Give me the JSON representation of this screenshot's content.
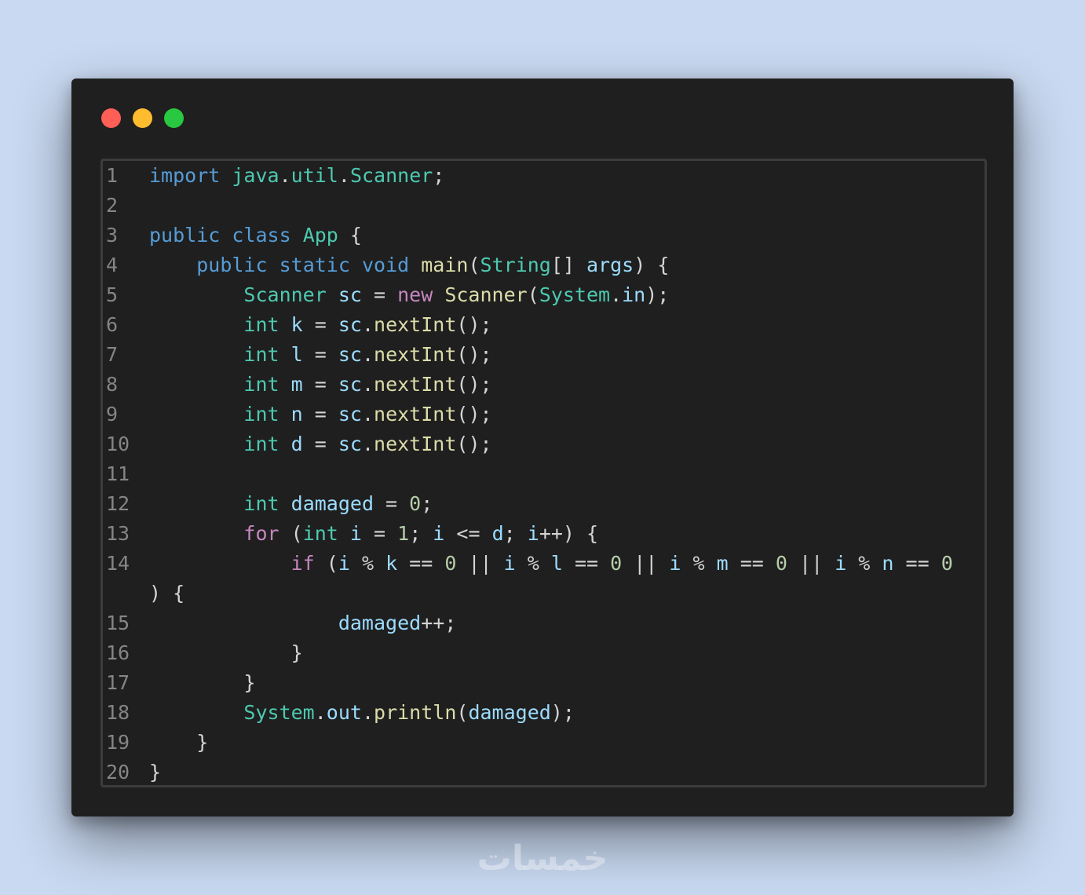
{
  "window": {
    "controls": [
      "close",
      "minimize",
      "maximize"
    ]
  },
  "code_lines": [
    {
      "n": "1",
      "tokens": [
        [
          "kw",
          "import"
        ],
        [
          "pun",
          " "
        ],
        [
          "ty",
          "java"
        ],
        [
          "pun",
          "."
        ],
        [
          "ty",
          "util"
        ],
        [
          "pun",
          "."
        ],
        [
          "ty",
          "Scanner"
        ],
        [
          "pun",
          ";"
        ]
      ]
    },
    {
      "n": "2",
      "tokens": []
    },
    {
      "n": "3",
      "tokens": [
        [
          "kw",
          "public"
        ],
        [
          "pun",
          " "
        ],
        [
          "kw",
          "class"
        ],
        [
          "pun",
          " "
        ],
        [
          "ty",
          "App"
        ],
        [
          "pun",
          " {"
        ]
      ]
    },
    {
      "n": "4",
      "tokens": [
        [
          "pun",
          "    "
        ],
        [
          "kw",
          "public"
        ],
        [
          "pun",
          " "
        ],
        [
          "kw",
          "static"
        ],
        [
          "pun",
          " "
        ],
        [
          "kw",
          "void"
        ],
        [
          "pun",
          " "
        ],
        [
          "fn",
          "main"
        ],
        [
          "pun",
          "("
        ],
        [
          "ty",
          "String"
        ],
        [
          "pun",
          "[] "
        ],
        [
          "var",
          "args"
        ],
        [
          "pun",
          ") {"
        ]
      ]
    },
    {
      "n": "5",
      "tokens": [
        [
          "pun",
          "        "
        ],
        [
          "ty",
          "Scanner"
        ],
        [
          "pun",
          " "
        ],
        [
          "var",
          "sc"
        ],
        [
          "pun",
          " = "
        ],
        [
          "ctl",
          "new"
        ],
        [
          "pun",
          " "
        ],
        [
          "fn",
          "Scanner"
        ],
        [
          "pun",
          "("
        ],
        [
          "ty",
          "System"
        ],
        [
          "pun",
          "."
        ],
        [
          "var",
          "in"
        ],
        [
          "pun",
          ");"
        ]
      ]
    },
    {
      "n": "6",
      "tokens": [
        [
          "pun",
          "        "
        ],
        [
          "ty",
          "int"
        ],
        [
          "pun",
          " "
        ],
        [
          "var",
          "k"
        ],
        [
          "pun",
          " = "
        ],
        [
          "var",
          "sc"
        ],
        [
          "pun",
          "."
        ],
        [
          "fn",
          "nextInt"
        ],
        [
          "pun",
          "();"
        ]
      ]
    },
    {
      "n": "7",
      "tokens": [
        [
          "pun",
          "        "
        ],
        [
          "ty",
          "int"
        ],
        [
          "pun",
          " "
        ],
        [
          "var",
          "l"
        ],
        [
          "pun",
          " = "
        ],
        [
          "var",
          "sc"
        ],
        [
          "pun",
          "."
        ],
        [
          "fn",
          "nextInt"
        ],
        [
          "pun",
          "();"
        ]
      ]
    },
    {
      "n": "8",
      "tokens": [
        [
          "pun",
          "        "
        ],
        [
          "ty",
          "int"
        ],
        [
          "pun",
          " "
        ],
        [
          "var",
          "m"
        ],
        [
          "pun",
          " = "
        ],
        [
          "var",
          "sc"
        ],
        [
          "pun",
          "."
        ],
        [
          "fn",
          "nextInt"
        ],
        [
          "pun",
          "();"
        ]
      ]
    },
    {
      "n": "9",
      "tokens": [
        [
          "pun",
          "        "
        ],
        [
          "ty",
          "int"
        ],
        [
          "pun",
          " "
        ],
        [
          "var",
          "n"
        ],
        [
          "pun",
          " = "
        ],
        [
          "var",
          "sc"
        ],
        [
          "pun",
          "."
        ],
        [
          "fn",
          "nextInt"
        ],
        [
          "pun",
          "();"
        ]
      ]
    },
    {
      "n": "10",
      "tokens": [
        [
          "pun",
          "        "
        ],
        [
          "ty",
          "int"
        ],
        [
          "pun",
          " "
        ],
        [
          "var",
          "d"
        ],
        [
          "pun",
          " = "
        ],
        [
          "var",
          "sc"
        ],
        [
          "pun",
          "."
        ],
        [
          "fn",
          "nextInt"
        ],
        [
          "pun",
          "();"
        ]
      ]
    },
    {
      "n": "11",
      "tokens": []
    },
    {
      "n": "12",
      "tokens": [
        [
          "pun",
          "        "
        ],
        [
          "ty",
          "int"
        ],
        [
          "pun",
          " "
        ],
        [
          "var",
          "damaged"
        ],
        [
          "pun",
          " = "
        ],
        [
          "num",
          "0"
        ],
        [
          "pun",
          ";"
        ]
      ]
    },
    {
      "n": "13",
      "tokens": [
        [
          "pun",
          "        "
        ],
        [
          "ctl",
          "for"
        ],
        [
          "pun",
          " ("
        ],
        [
          "ty",
          "int"
        ],
        [
          "pun",
          " "
        ],
        [
          "var",
          "i"
        ],
        [
          "pun",
          " = "
        ],
        [
          "num",
          "1"
        ],
        [
          "pun",
          "; "
        ],
        [
          "var",
          "i"
        ],
        [
          "pun",
          " <= "
        ],
        [
          "var",
          "d"
        ],
        [
          "pun",
          "; "
        ],
        [
          "var",
          "i"
        ],
        [
          "pun",
          "++) {"
        ]
      ]
    },
    {
      "n": "14",
      "tokens": [
        [
          "pun",
          "            "
        ],
        [
          "ctl",
          "if"
        ],
        [
          "pun",
          " ("
        ],
        [
          "var",
          "i"
        ],
        [
          "pun",
          " % "
        ],
        [
          "var",
          "k"
        ],
        [
          "pun",
          " == "
        ],
        [
          "num",
          "0"
        ],
        [
          "pun",
          " || "
        ],
        [
          "var",
          "i"
        ],
        [
          "pun",
          " % "
        ],
        [
          "var",
          "l"
        ],
        [
          "pun",
          " == "
        ],
        [
          "num",
          "0"
        ],
        [
          "pun",
          " || "
        ],
        [
          "var",
          "i"
        ],
        [
          "pun",
          " % "
        ],
        [
          "var",
          "m"
        ],
        [
          "pun",
          " == "
        ],
        [
          "num",
          "0"
        ],
        [
          "pun",
          " || "
        ],
        [
          "var",
          "i"
        ],
        [
          "pun",
          " % "
        ],
        [
          "var",
          "n"
        ],
        [
          "pun",
          " == "
        ],
        [
          "num",
          "0"
        ]
      ]
    },
    {
      "n": "",
      "tokens": [
        [
          "pun",
          ") {"
        ]
      ]
    },
    {
      "n": "15",
      "tokens": [
        [
          "pun",
          "                "
        ],
        [
          "var",
          "damaged"
        ],
        [
          "pun",
          "++;"
        ]
      ]
    },
    {
      "n": "16",
      "tokens": [
        [
          "pun",
          "            }"
        ]
      ]
    },
    {
      "n": "17",
      "tokens": [
        [
          "pun",
          "        }"
        ]
      ]
    },
    {
      "n": "18",
      "tokens": [
        [
          "pun",
          "        "
        ],
        [
          "ty",
          "System"
        ],
        [
          "pun",
          "."
        ],
        [
          "var",
          "out"
        ],
        [
          "pun",
          "."
        ],
        [
          "fn",
          "println"
        ],
        [
          "pun",
          "("
        ],
        [
          "var",
          "damaged"
        ],
        [
          "pun",
          ");"
        ]
      ]
    },
    {
      "n": "19",
      "tokens": [
        [
          "pun",
          "    }"
        ]
      ]
    },
    {
      "n": "20",
      "tokens": [
        [
          "pun",
          "}"
        ]
      ]
    }
  ],
  "watermark": "خمسات"
}
